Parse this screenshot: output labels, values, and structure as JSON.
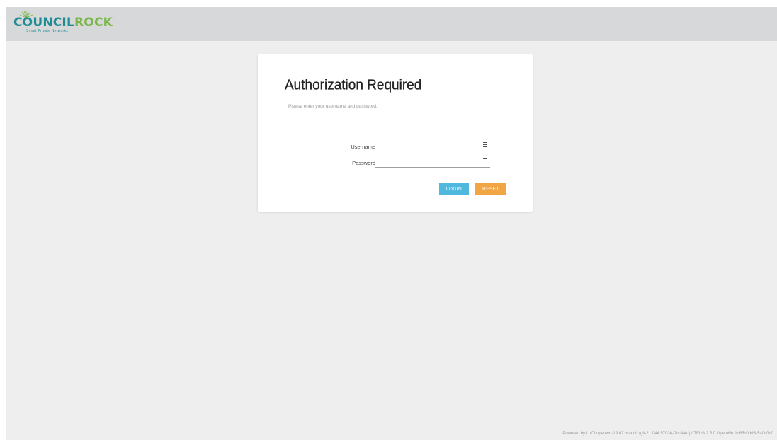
{
  "brand": {
    "name_part1": "COUNCIL",
    "name_part2": "ROCK",
    "tagline": "Smart Private Networks",
    "colors": {
      "council": "#1f8b93",
      "rock": "#7ab648"
    }
  },
  "login": {
    "title": "Authorization Required",
    "subtitle": "Please enter your username and password.",
    "username_label": "Username",
    "username_value": "",
    "password_label": "Password",
    "password_value": "",
    "login_button": "LOGIN",
    "reset_button": "RESET",
    "field_icon": "list-icon"
  },
  "colors": {
    "login_button": "#4fb8dc",
    "reset_button": "#f1a545",
    "topbar": "#d6d8da",
    "page_bg": "#eeeeee"
  },
  "footer": {
    "text": "Powered by LuCI openwrt-19.07 branch (git-21.044.57038-0bc4f4d) / TELG 2.5.0 OpenWrt 1c65b0d63-5a0c0b0"
  }
}
